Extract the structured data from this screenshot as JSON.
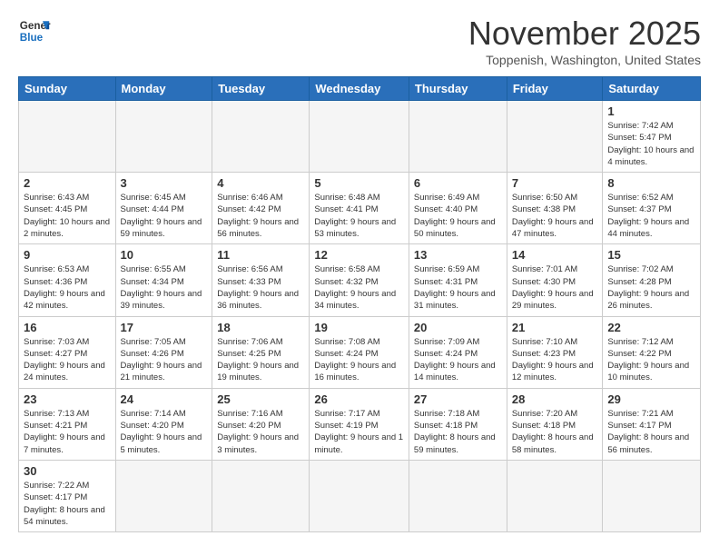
{
  "logo": {
    "line1": "General",
    "line2": "Blue"
  },
  "title": "November 2025",
  "subtitle": "Toppenish, Washington, United States",
  "weekdays": [
    "Sunday",
    "Monday",
    "Tuesday",
    "Wednesday",
    "Thursday",
    "Friday",
    "Saturday"
  ],
  "weeks": [
    [
      {
        "day": "",
        "info": ""
      },
      {
        "day": "",
        "info": ""
      },
      {
        "day": "",
        "info": ""
      },
      {
        "day": "",
        "info": ""
      },
      {
        "day": "",
        "info": ""
      },
      {
        "day": "",
        "info": ""
      },
      {
        "day": "1",
        "info": "Sunrise: 7:42 AM\nSunset: 5:47 PM\nDaylight: 10 hours and 4 minutes."
      }
    ],
    [
      {
        "day": "2",
        "info": "Sunrise: 6:43 AM\nSunset: 4:45 PM\nDaylight: 10 hours and 2 minutes."
      },
      {
        "day": "3",
        "info": "Sunrise: 6:45 AM\nSunset: 4:44 PM\nDaylight: 9 hours and 59 minutes."
      },
      {
        "day": "4",
        "info": "Sunrise: 6:46 AM\nSunset: 4:42 PM\nDaylight: 9 hours and 56 minutes."
      },
      {
        "day": "5",
        "info": "Sunrise: 6:48 AM\nSunset: 4:41 PM\nDaylight: 9 hours and 53 minutes."
      },
      {
        "day": "6",
        "info": "Sunrise: 6:49 AM\nSunset: 4:40 PM\nDaylight: 9 hours and 50 minutes."
      },
      {
        "day": "7",
        "info": "Sunrise: 6:50 AM\nSunset: 4:38 PM\nDaylight: 9 hours and 47 minutes."
      },
      {
        "day": "8",
        "info": "Sunrise: 6:52 AM\nSunset: 4:37 PM\nDaylight: 9 hours and 44 minutes."
      }
    ],
    [
      {
        "day": "9",
        "info": "Sunrise: 6:53 AM\nSunset: 4:36 PM\nDaylight: 9 hours and 42 minutes."
      },
      {
        "day": "10",
        "info": "Sunrise: 6:55 AM\nSunset: 4:34 PM\nDaylight: 9 hours and 39 minutes."
      },
      {
        "day": "11",
        "info": "Sunrise: 6:56 AM\nSunset: 4:33 PM\nDaylight: 9 hours and 36 minutes."
      },
      {
        "day": "12",
        "info": "Sunrise: 6:58 AM\nSunset: 4:32 PM\nDaylight: 9 hours and 34 minutes."
      },
      {
        "day": "13",
        "info": "Sunrise: 6:59 AM\nSunset: 4:31 PM\nDaylight: 9 hours and 31 minutes."
      },
      {
        "day": "14",
        "info": "Sunrise: 7:01 AM\nSunset: 4:30 PM\nDaylight: 9 hours and 29 minutes."
      },
      {
        "day": "15",
        "info": "Sunrise: 7:02 AM\nSunset: 4:28 PM\nDaylight: 9 hours and 26 minutes."
      }
    ],
    [
      {
        "day": "16",
        "info": "Sunrise: 7:03 AM\nSunset: 4:27 PM\nDaylight: 9 hours and 24 minutes."
      },
      {
        "day": "17",
        "info": "Sunrise: 7:05 AM\nSunset: 4:26 PM\nDaylight: 9 hours and 21 minutes."
      },
      {
        "day": "18",
        "info": "Sunrise: 7:06 AM\nSunset: 4:25 PM\nDaylight: 9 hours and 19 minutes."
      },
      {
        "day": "19",
        "info": "Sunrise: 7:08 AM\nSunset: 4:24 PM\nDaylight: 9 hours and 16 minutes."
      },
      {
        "day": "20",
        "info": "Sunrise: 7:09 AM\nSunset: 4:24 PM\nDaylight: 9 hours and 14 minutes."
      },
      {
        "day": "21",
        "info": "Sunrise: 7:10 AM\nSunset: 4:23 PM\nDaylight: 9 hours and 12 minutes."
      },
      {
        "day": "22",
        "info": "Sunrise: 7:12 AM\nSunset: 4:22 PM\nDaylight: 9 hours and 10 minutes."
      }
    ],
    [
      {
        "day": "23",
        "info": "Sunrise: 7:13 AM\nSunset: 4:21 PM\nDaylight: 9 hours and 7 minutes."
      },
      {
        "day": "24",
        "info": "Sunrise: 7:14 AM\nSunset: 4:20 PM\nDaylight: 9 hours and 5 minutes."
      },
      {
        "day": "25",
        "info": "Sunrise: 7:16 AM\nSunset: 4:20 PM\nDaylight: 9 hours and 3 minutes."
      },
      {
        "day": "26",
        "info": "Sunrise: 7:17 AM\nSunset: 4:19 PM\nDaylight: 9 hours and 1 minute."
      },
      {
        "day": "27",
        "info": "Sunrise: 7:18 AM\nSunset: 4:18 PM\nDaylight: 8 hours and 59 minutes."
      },
      {
        "day": "28",
        "info": "Sunrise: 7:20 AM\nSunset: 4:18 PM\nDaylight: 8 hours and 58 minutes."
      },
      {
        "day": "29",
        "info": "Sunrise: 7:21 AM\nSunset: 4:17 PM\nDaylight: 8 hours and 56 minutes."
      }
    ],
    [
      {
        "day": "30",
        "info": "Sunrise: 7:22 AM\nSunset: 4:17 PM\nDaylight: 8 hours and 54 minutes."
      },
      {
        "day": "",
        "info": ""
      },
      {
        "day": "",
        "info": ""
      },
      {
        "day": "",
        "info": ""
      },
      {
        "day": "",
        "info": ""
      },
      {
        "day": "",
        "info": ""
      },
      {
        "day": "",
        "info": ""
      }
    ]
  ]
}
